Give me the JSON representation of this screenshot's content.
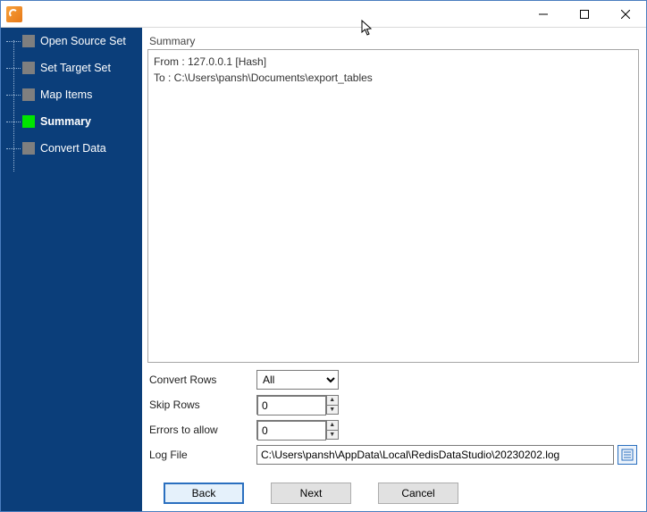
{
  "sidebar": {
    "items": [
      {
        "label": "Open Source Set"
      },
      {
        "label": "Set Target Set"
      },
      {
        "label": "Map Items"
      },
      {
        "label": "Summary"
      },
      {
        "label": "Convert Data"
      }
    ],
    "activeIndex": 3
  },
  "content": {
    "section_title": "Summary",
    "summary_text": "From : 127.0.0.1 [Hash]\nTo : C:\\Users\\pansh\\Documents\\export_tables"
  },
  "form": {
    "convert_rows": {
      "label": "Convert Rows",
      "value": "All",
      "options": [
        "All"
      ]
    },
    "skip_rows": {
      "label": "Skip Rows",
      "value": "0"
    },
    "errors_allow": {
      "label": "Errors to allow",
      "value": "0"
    },
    "log_file": {
      "label": "Log File",
      "value": "C:\\Users\\pansh\\AppData\\Local\\RedisDataStudio\\20230202.log"
    }
  },
  "buttons": {
    "back": "Back",
    "next": "Next",
    "cancel": "Cancel"
  }
}
